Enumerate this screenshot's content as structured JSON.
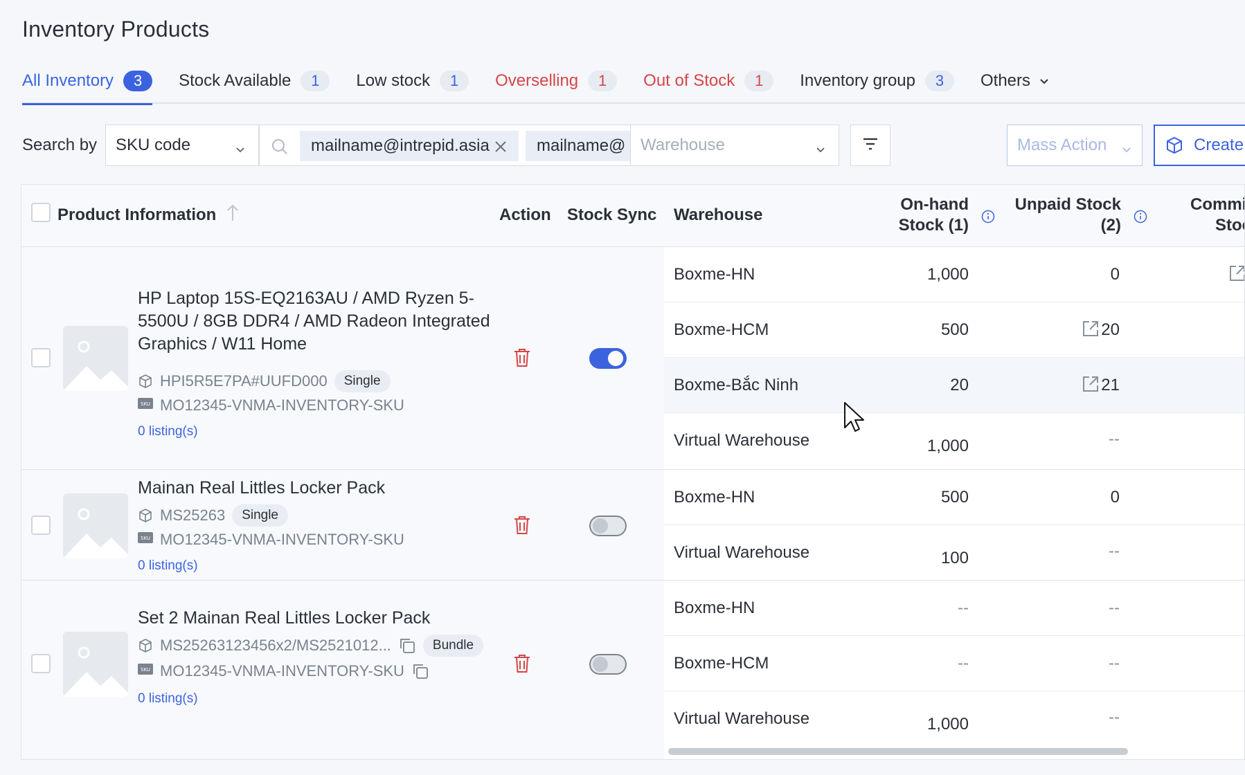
{
  "page": {
    "title": "Inventory Products"
  },
  "tabs": [
    {
      "label": "All Inventory",
      "count": "3"
    },
    {
      "label": "Stock Available",
      "count": "1"
    },
    {
      "label": "Low stock",
      "count": "1"
    },
    {
      "label": "Overselling",
      "count": "1"
    },
    {
      "label": "Out of Stock",
      "count": "1"
    },
    {
      "label": "Inventory group",
      "count": "3"
    },
    {
      "label": "Others"
    }
  ],
  "filters": {
    "search_by_label": "Search by",
    "search_field": "SKU code",
    "chips": [
      "mailname@intrepid.asia",
      "mailname@"
    ],
    "warehouse_placeholder": "Warehouse",
    "mass_action": "Mass Action",
    "create": "Create"
  },
  "table": {
    "headers": {
      "product": "Product Information",
      "action": "Action",
      "stock_sync": "Stock Sync",
      "warehouse": "Warehouse",
      "onhand_1": "On-hand",
      "onhand_2": "Stock (1)",
      "unpaid_1": "Unpaid Stock",
      "unpaid_2": "(2)",
      "committed_1": "Commit",
      "committed_2": "Stock"
    },
    "products": [
      {
        "name": "HP Laptop 15S-EQ2163AU / AMD Ryzen 5-5500U / 8GB DDR4 / AMD Radeon Integrated Graphics / W11 Home",
        "product_code": "HPI5R5E7PA#UUFD000",
        "type": "Single",
        "sku": "MO12345-VNMA-INVENTORY-SKU",
        "listings": "0 listing(s)",
        "stock_sync": true,
        "warehouses": [
          {
            "name": "Boxme-HN",
            "onhand": "1,000",
            "unpaid": "0"
          },
          {
            "name": "Boxme-HCM",
            "onhand": "500",
            "unpaid": "20"
          },
          {
            "name": "Boxme-Bắc Ninh",
            "onhand": "20",
            "unpaid": "21"
          },
          {
            "name": "Virtual Warehouse",
            "onhand": "1,000",
            "unpaid": "--"
          }
        ]
      },
      {
        "name": "Mainan Real Littles Locker Pack",
        "product_code": "MS25263",
        "type": "Single",
        "sku": "MO12345-VNMA-INVENTORY-SKU",
        "listings": "0 listing(s)",
        "stock_sync": false,
        "warehouses": [
          {
            "name": "Boxme-HN",
            "onhand": "500",
            "unpaid": "0"
          },
          {
            "name": "Virtual Warehouse",
            "onhand": "100",
            "unpaid": "--"
          }
        ]
      },
      {
        "name": "Set 2 Mainan Real Littles Locker Pack",
        "product_code": "MS25263123456x2/MS2521012...",
        "type": "Bundle",
        "sku": "MO12345-VNMA-INVENTORY-SKU",
        "listings": "0 listing(s)",
        "stock_sync": false,
        "warehouses": [
          {
            "name": "Boxme-HN",
            "onhand": "--",
            "unpaid": "--"
          },
          {
            "name": "Boxme-HCM",
            "onhand": "--",
            "unpaid": "--"
          },
          {
            "name": "Virtual Warehouse",
            "onhand": "1,000",
            "unpaid": "--"
          }
        ]
      }
    ]
  },
  "colors": {
    "accent": "#3b63e0",
    "danger": "#d64545",
    "border": "#dfe3ea"
  }
}
